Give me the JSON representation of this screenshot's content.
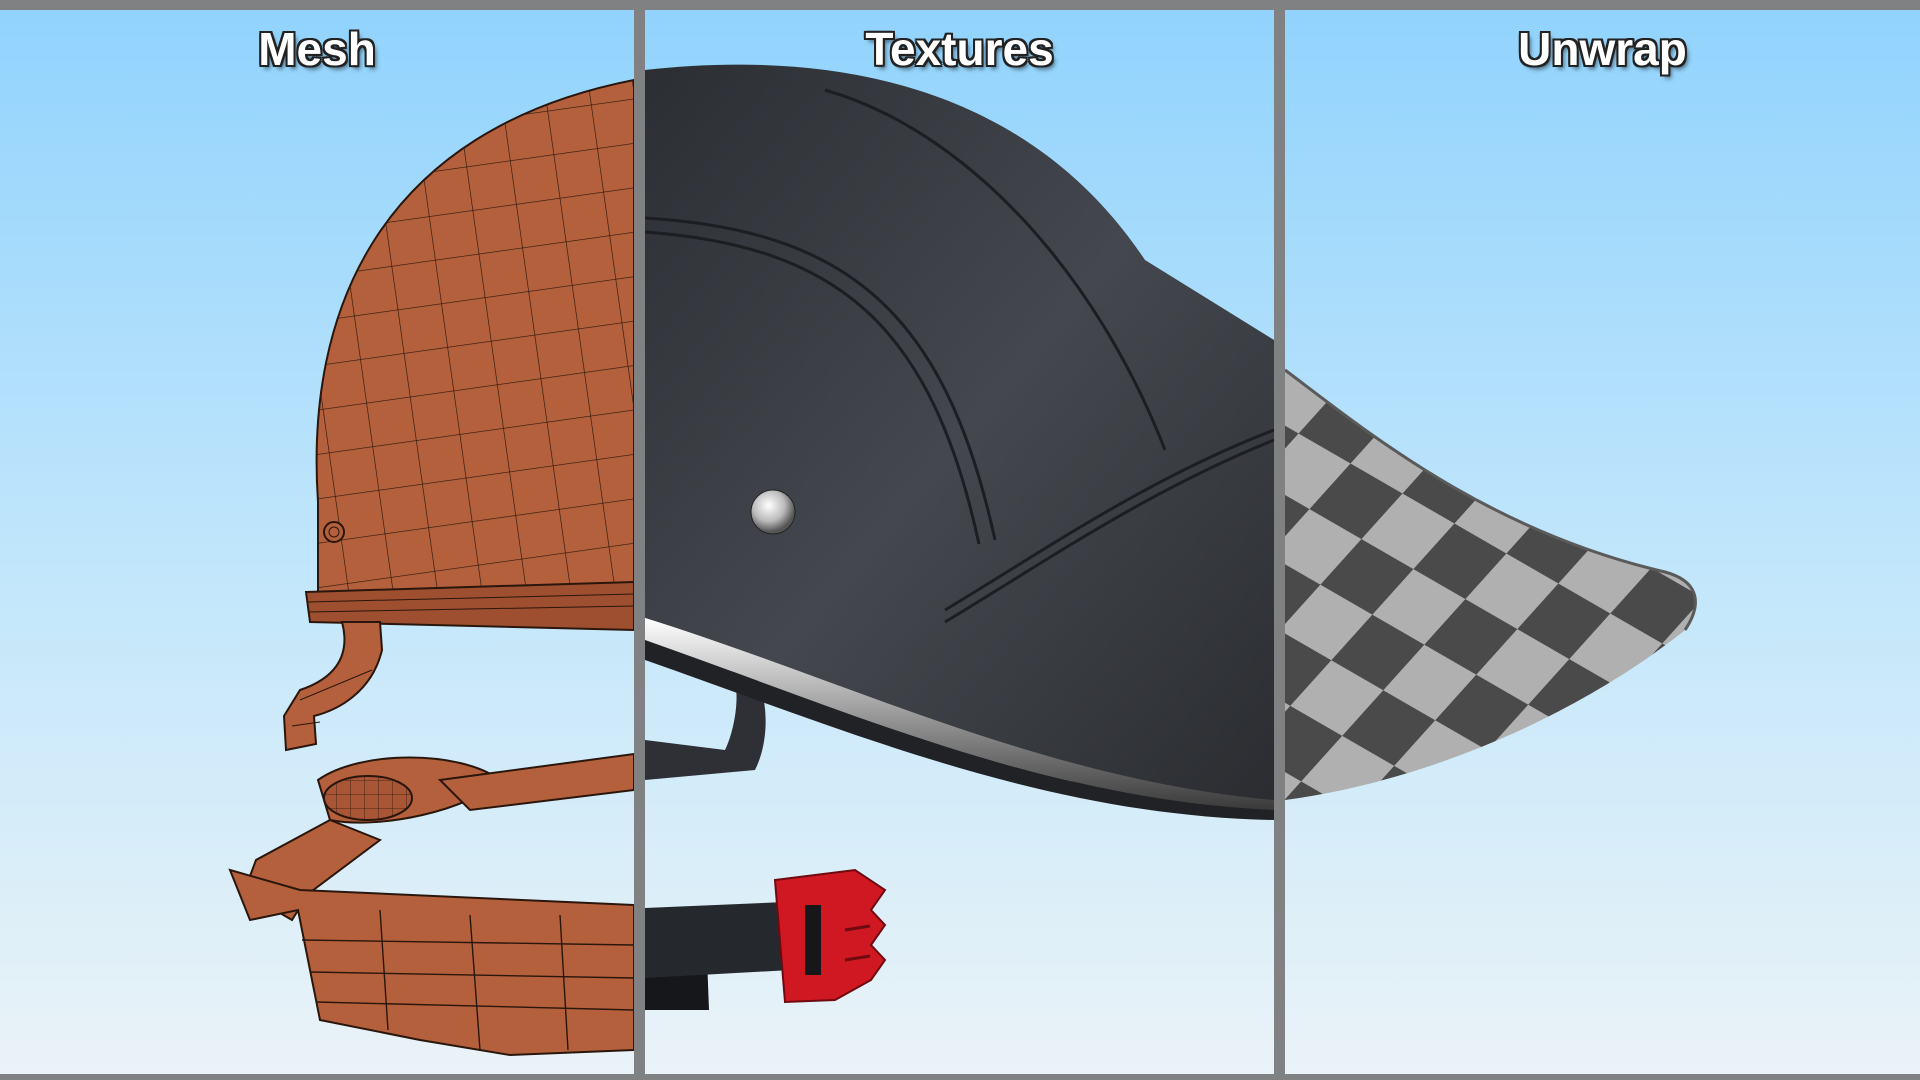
{
  "panels": {
    "mesh": {
      "label": "Mesh"
    },
    "textures": {
      "label": "Textures"
    },
    "unwrap": {
      "label": "Unwrap"
    }
  },
  "colors": {
    "frame": "#7f8183",
    "sky_top": "#91d3fd",
    "sky_bottom": "#eaf3f7",
    "mesh_fill": "#b4603c",
    "leather": "#3a3d42",
    "buckle": "#d01822",
    "checker_dark": "#4a4a4a",
    "checker_light": "#b0b0b0"
  }
}
